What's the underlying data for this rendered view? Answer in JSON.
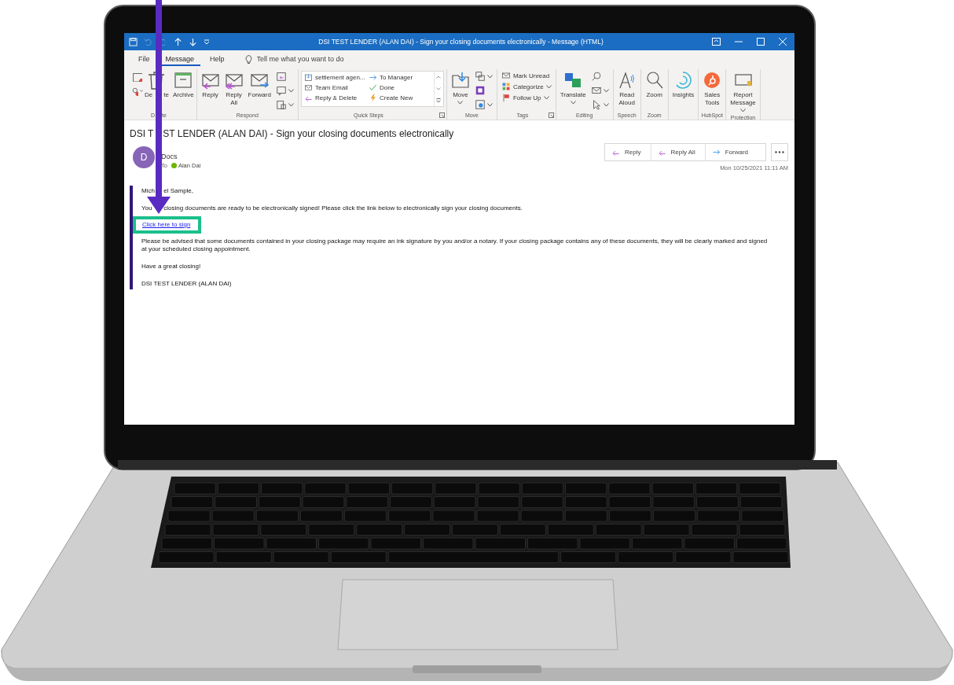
{
  "title_bar": {
    "title": "DSI TEST LENDER (ALAN DAI) - Sign your closing documents electronically  -  Message (HTML)"
  },
  "tabs": [
    {
      "label": "File",
      "selected": false
    },
    {
      "label": "Message",
      "selected": true
    },
    {
      "label": "Help",
      "selected": false
    }
  ],
  "tell_me": {
    "placeholder": "Tell me what you want to do"
  },
  "ribbon": [
    {
      "label": [
        "D",
        "te"
      ],
      "items": [
        {
          "kind": "small",
          "dropdowns": [
            false,
            true
          ]
        },
        {
          "kind": "large",
          "label": [
            "De",
            "te"
          ],
          "dropdown": false
        },
        {
          "kind": "large",
          "label": "Archive",
          "dropdown": false
        }
      ]
    },
    {
      "label": "Respond",
      "items": [
        {
          "kind": "large",
          "label": "Reply",
          "dropdown": false
        },
        {
          "kind": "large",
          "label": "Reply All",
          "dropdown": false
        },
        {
          "kind": "large",
          "label": "Forward",
          "dropdown": false
        },
        {
          "kind": "small",
          "dropdowns": [
            false,
            true,
            true
          ]
        }
      ]
    },
    {
      "label": "Quick Steps",
      "launcher": true,
      "items": [
        {
          "kind": "gallery",
          "entries": [
            "settlement agen...",
            "To Manager",
            "Team Email",
            "Done",
            "Reply & Delete",
            "Create New"
          ]
        }
      ]
    },
    {
      "label": "Move",
      "items": [
        {
          "kind": "large",
          "label": "Move",
          "dropdown": true
        },
        {
          "kind": "small",
          "dropdowns": [
            true,
            false,
            true
          ]
        }
      ]
    },
    {
      "label": "Tags",
      "launcher": true,
      "items": [
        {
          "kind": "rows",
          "rows": [
            {
              "label": "Mark Unread",
              "dropdown": false
            },
            {
              "label": "Categorize",
              "dropdown": true
            },
            {
              "label": "Follow Up",
              "dropdown": true
            }
          ]
        }
      ]
    },
    {
      "label": "Editing",
      "items": [
        {
          "kind": "large",
          "label": "Translate",
          "dropdown": true
        },
        {
          "kind": "small",
          "dropdowns": [
            false,
            true,
            true
          ]
        }
      ]
    },
    {
      "label": "Speech",
      "items": [
        {
          "kind": "large",
          "label": "Read Aloud",
          "dropdown": false
        }
      ]
    },
    {
      "label": "Zoom",
      "items": [
        {
          "kind": "large",
          "label": "Zoom",
          "dropdown": false
        }
      ]
    },
    {
      "items": [
        {
          "kind": "large",
          "label": "Insights",
          "dropdown": false
        }
      ]
    },
    {
      "label": "HubSpot",
      "items": [
        {
          "kind": "large",
          "label": "Sales Tools",
          "dropdown": false
        }
      ]
    },
    {
      "label": "Protection",
      "items": [
        {
          "kind": "large",
          "label": "Report Message",
          "dropdown": true
        }
      ]
    }
  ],
  "message": {
    "subject": [
      "DSI T",
      "ST LENDER (ALAN DAI) - Sign your closing documents electronically"
    ],
    "sender": {
      "initial": "D",
      "name": "Docs"
    },
    "to_label": "To",
    "recipient": "Alan Dai",
    "actions": [
      {
        "label": "Reply"
      },
      {
        "label": "Reply All"
      },
      {
        "label": "Forward"
      }
    ],
    "date": "Mon 10/25/2021 11:11 AM",
    "body": [
      {
        "kind": "text",
        "text": [
          "Mich",
          "el Sample,"
        ]
      },
      {
        "kind": "text",
        "text": [
          "You",
          "closing documents are ready to be electronically signed! Please click the link below to electronically sign your closing documents."
        ]
      },
      {
        "kind": "link",
        "text": "Click here to sign",
        "highlighted": true
      },
      {
        "kind": "text",
        "text": "Please be advised that some documents contained in your closing package may require an ink signature by you and/or a notary. If your closing package contains any of these documents, they will be clearly marked and signed at your scheduled closing appointment."
      },
      {
        "kind": "text",
        "text": "Have a great closing!"
      },
      {
        "kind": "text",
        "text": "DSI TEST LENDER (ALAN DAI)"
      }
    ]
  }
}
